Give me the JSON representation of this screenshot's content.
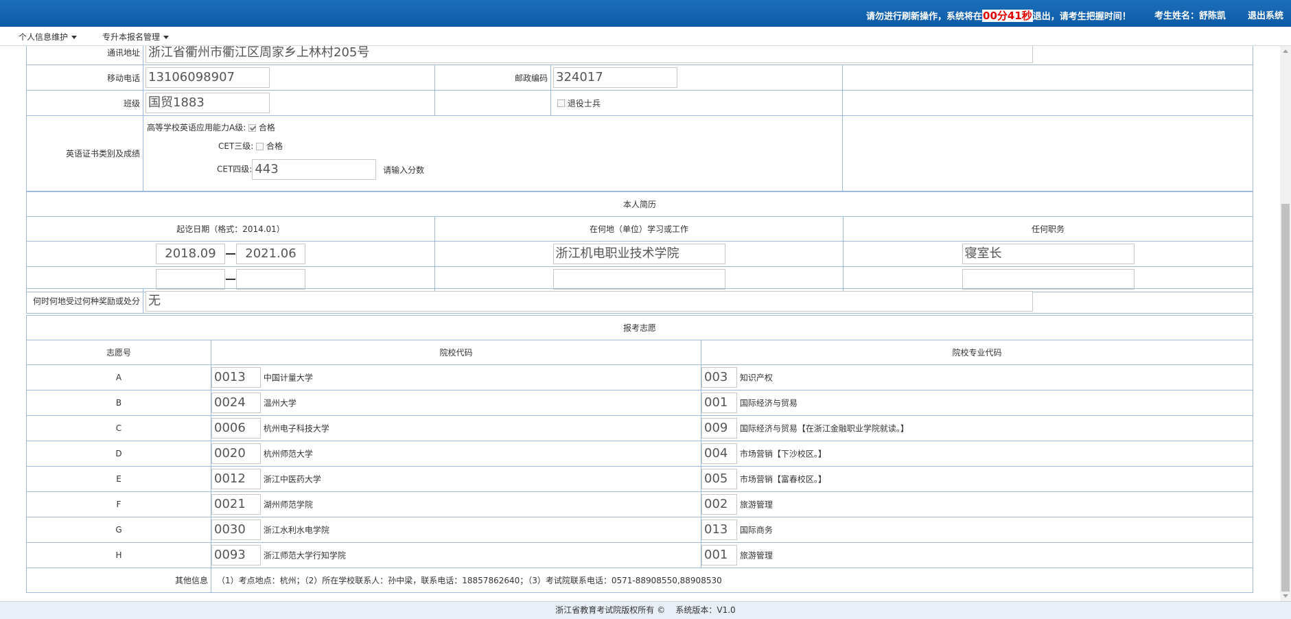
{
  "header": {
    "warning_prefix": "请勿进行刷新操作，系统将在",
    "timer": "00分41秒",
    "warning_suffix": "退出，请考生把握时间！",
    "candidate": "考生姓名：舒陈凯",
    "logout": "退出系统"
  },
  "menu": [
    {
      "label": "个人信息维护"
    },
    {
      "label": "专升本报名管理"
    }
  ],
  "personal": {
    "address_label": "通讯地址",
    "address": "浙江省衢州市衢江区周家乡上林村205号",
    "mobile_label": "移动电话",
    "mobile": "13106098907",
    "postcode_label": "邮政编码",
    "postcode": "324017",
    "class_label": "班级",
    "class": "国贸1883",
    "veteran_label": "退役士兵",
    "veteran_checked": false,
    "english_label": "英语证书类别及成绩",
    "eng_a_label": "高等学校英语应用能力A级:",
    "eng_a_checked": true,
    "eng_a_pass": "合格",
    "cet3_label": "CET三级:",
    "cet3_checked": false,
    "cet3_pass": "合格",
    "cet4_label": "CET四级:",
    "cet4_score": "443",
    "cet4_hint": "请输入分数"
  },
  "resume": {
    "title": "本人简历",
    "col_dates": "起讫日期（格式：2014.01）",
    "col_place": "在何地（单位）学习或工作",
    "col_position": "任何职务",
    "rows": [
      {
        "start": "2018.09",
        "end": "2021.06",
        "place": "浙江机电职业技术学院",
        "position": "寝室长"
      },
      {
        "start": "",
        "end": "",
        "place": "",
        "position": ""
      }
    ],
    "awards_label": "何时何地受过何种奖励或处分",
    "awards": "无"
  },
  "choices": {
    "title": "报考志愿",
    "col_no": "志愿号",
    "col_school": "院校代码",
    "col_major": "院校专业代码",
    "rows": [
      {
        "no": "A",
        "school_code": "0013",
        "school_name": "中国计量大学",
        "major_code": "003",
        "major_name": "知识产权"
      },
      {
        "no": "B",
        "school_code": "0024",
        "school_name": "温州大学",
        "major_code": "001",
        "major_name": "国际经济与贸易"
      },
      {
        "no": "C",
        "school_code": "0006",
        "school_name": "杭州电子科技大学",
        "major_code": "009",
        "major_name": "国际经济与贸易【在浙江金融职业学院就读。】"
      },
      {
        "no": "D",
        "school_code": "0020",
        "school_name": "杭州师范大学",
        "major_code": "004",
        "major_name": "市场营销【下沙校区。】"
      },
      {
        "no": "E",
        "school_code": "0012",
        "school_name": "浙江中医药大学",
        "major_code": "005",
        "major_name": "市场营销【富春校区。】"
      },
      {
        "no": "F",
        "school_code": "0021",
        "school_name": "湖州师范学院",
        "major_code": "002",
        "major_name": "旅游管理"
      },
      {
        "no": "G",
        "school_code": "0030",
        "school_name": "浙江水利水电学院",
        "major_code": "013",
        "major_name": "国际商务"
      },
      {
        "no": "H",
        "school_code": "0093",
        "school_name": "浙江师范大学行知学院",
        "major_code": "001",
        "major_name": "旅游管理"
      }
    ],
    "other_label": "其他信息",
    "other": "（1）考点地点：杭州；（2）所在学校联系人：孙中梁，联系电话：18857862640；（3）考试院联系电话：0571-88908550,88908530"
  },
  "footer": {
    "copyright": "浙江省教育考试院版权所有 ©",
    "version": "系统版本：V1.0"
  }
}
